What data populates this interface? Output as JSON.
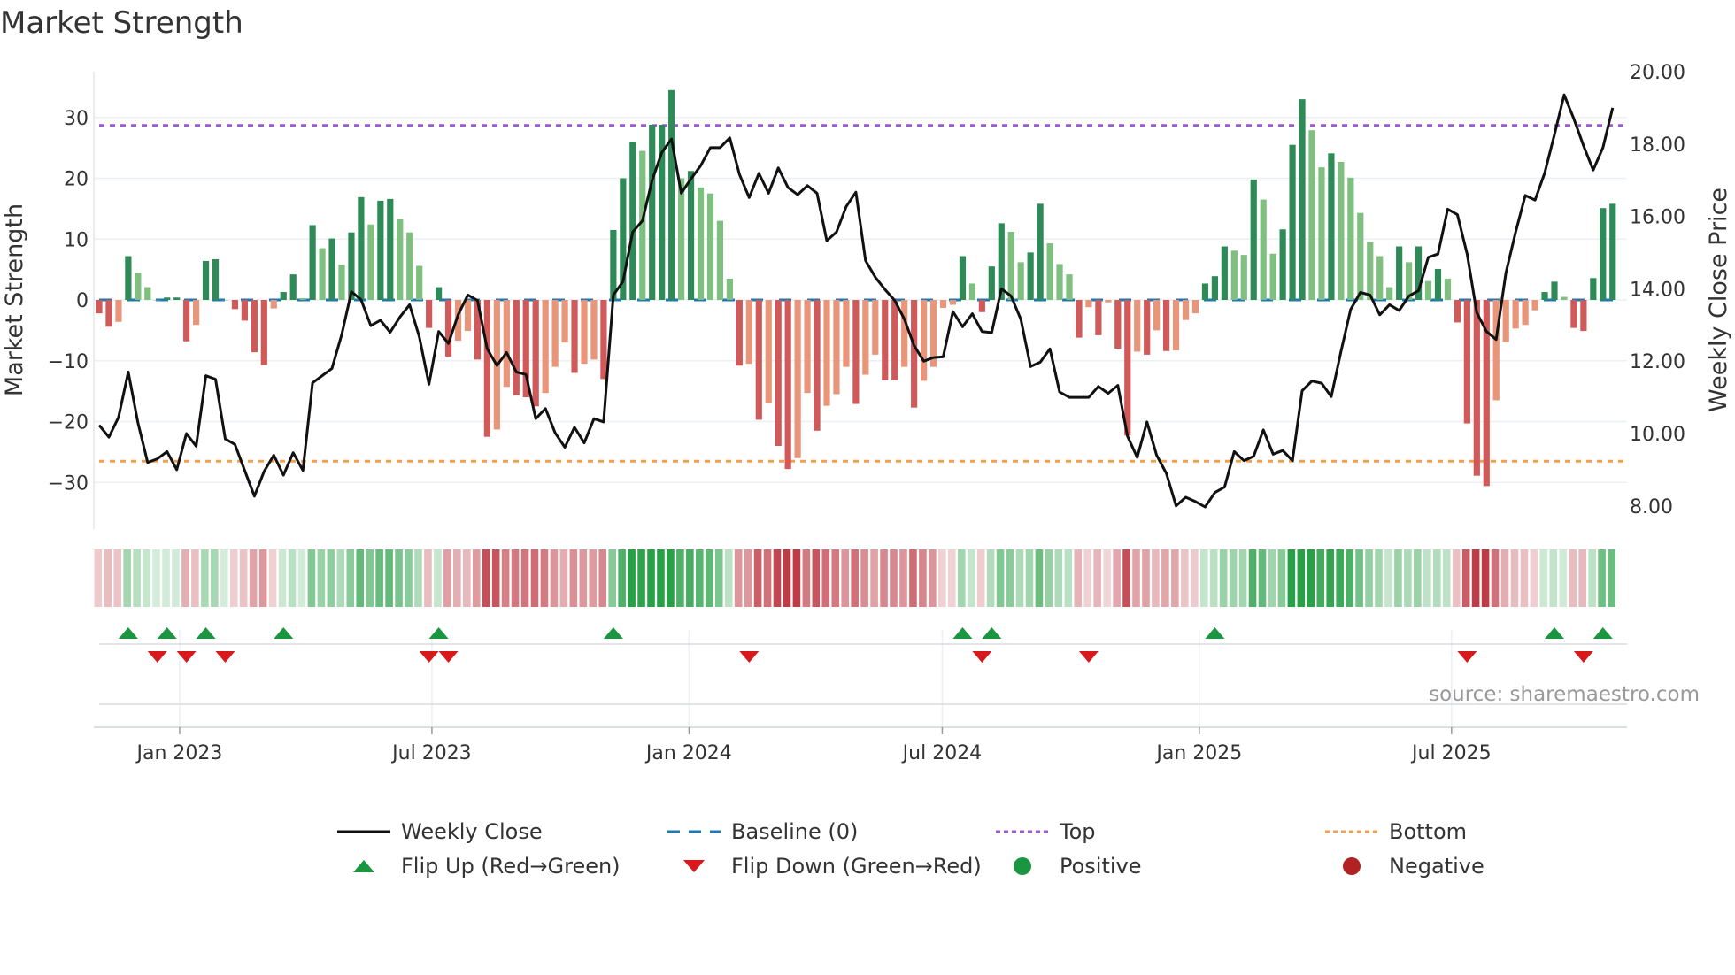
{
  "title": "Market Strength",
  "source": "source: sharemaestro.com",
  "colors": {
    "pos_dark": "#2e8b57",
    "pos_light": "#7fbf7f",
    "neg_dark": "#d05a5a",
    "neg_light": "#e8957a",
    "line": "#111111",
    "baseline": "#1f77b4",
    "top": "#9b59d6",
    "bottom": "#f0a050",
    "flip_up": "#1a9641",
    "flip_down": "#d7191c",
    "positive": "#1a9641",
    "negative": "#b22222"
  },
  "chart_data": {
    "type": "bar+line",
    "title": "Market Strength",
    "ylabel": "Market Strength",
    "y2label": "Weekly Close Price",
    "ylim": [
      -37.5,
      39
    ],
    "y2lim": [
      8,
      20
    ],
    "yticks": [
      "30",
      "20",
      "10",
      "0",
      "−10",
      "−20",
      "−30"
    ],
    "ytick_values": [
      30,
      20,
      10,
      0,
      -10,
      -20,
      -30
    ],
    "y2ticks": [
      "20.00",
      "18.00",
      "16.00",
      "14.00",
      "12.00",
      "10.00",
      "8.00"
    ],
    "y2tick_values": [
      20,
      18,
      16,
      14,
      12,
      10,
      8
    ],
    "top_level": 28.7,
    "bottom_level": -26.5,
    "xticks": [
      {
        "label": "Jan 2023",
        "week": 8.3
      },
      {
        "label": "Jul 2023",
        "week": 34.3
      },
      {
        "label": "Jan 2024",
        "week": 60.8
      },
      {
        "label": "Jul 2024",
        "week": 86.9
      },
      {
        "label": "Jan 2025",
        "week": 113.4
      },
      {
        "label": "Jul 2025",
        "week": 139.4
      }
    ],
    "strength": [
      -2.2,
      -4.4,
      -3.6,
      7.2,
      4.5,
      2.1,
      0,
      0.4,
      0.4,
      -6.8,
      -4.1,
      6.4,
      6.7,
      0,
      -1.5,
      -3.4,
      -8.6,
      -10.7,
      -1.4,
      1.3,
      4.2,
      0.3,
      12.3,
      8.5,
      10.1,
      5.8,
      11.1,
      16.9,
      12.4,
      16.3,
      16.6,
      13.3,
      11.1,
      5.6,
      -4.6,
      2.1,
      -9.3,
      -6.7,
      -5.1,
      -9.8,
      -22.5,
      -21.3,
      -14.3,
      -15.7,
      -16,
      -17.5,
      -15.3,
      -11,
      -7,
      -12,
      -10.5,
      -9.8,
      -13,
      11.5,
      20,
      26,
      24.5,
      28.8,
      28.8,
      34.5,
      20,
      21.2,
      18.5,
      17.5,
      13,
      3.5,
      -10.8,
      -10.5,
      -19.7,
      -17,
      -24,
      -27.8,
      -26,
      -15.3,
      -21.5,
      -17.4,
      -15.5,
      -11,
      -17.1,
      -12.3,
      -9,
      -13.2,
      -13.2,
      -11,
      -17.7,
      -13.3,
      -11,
      -1.3,
      -0.8,
      7.2,
      2.7,
      -2,
      5.5,
      12.6,
      11.2,
      6.2,
      7.8,
      15.8,
      9.3,
      5.9,
      4.2,
      -6.2,
      -1.2,
      -5.8,
      -0.4,
      -8,
      -22.3,
      -8.5,
      -9,
      -5,
      -8.4,
      -8.3,
      -3.3,
      -2.2,
      2.7,
      3.9,
      8.8,
      8.1,
      7.4,
      19.8,
      16.5,
      7.6,
      11.6,
      25.5,
      33,
      27.9,
      21.8,
      24.1,
      22.7,
      20.1,
      14.3,
      9.5,
      7.2,
      2.1,
      8.8,
      6.2,
      8.8,
      3.1,
      5.1,
      3.5,
      -3.7,
      -20.3,
      -28.9,
      -30.6,
      -16.5,
      -6.9,
      -4.7,
      -4.1,
      -1.7,
      1.3,
      3,
      0.5,
      -4.6,
      -5.1,
      3.6,
      15.1,
      15.8
    ],
    "weekly_close": [
      10.23,
      9.9,
      10.45,
      11.7,
      10.3,
      9.2,
      9.3,
      9.5,
      9.0,
      10.0,
      9.65,
      11.6,
      11.5,
      9.85,
      9.7,
      8.98,
      8.27,
      8.95,
      9.4,
      8.85,
      9.47,
      8.98,
      11.4,
      11.6,
      11.8,
      12.73,
      13.92,
      13.7,
      12.98,
      13.13,
      12.8,
      13.22,
      13.56,
      12.67,
      11.36,
      12.82,
      12.49,
      13.28,
      13.83,
      13.68,
      12.34,
      11.88,
      12.24,
      11.7,
      11.63,
      10.41,
      10.69,
      10.02,
      9.62,
      10.17,
      9.74,
      10.41,
      10.32,
      13.83,
      14.2,
      15.57,
      15.88,
      17.0,
      17.77,
      18.14,
      16.64,
      17.04,
      17.4,
      17.9,
      17.9,
      18.17,
      17.16,
      16.52,
      17.19,
      16.64,
      17.34,
      16.8,
      16.6,
      16.85,
      16.64,
      15.33,
      15.57,
      16.27,
      16.67,
      14.78,
      14.32,
      13.98,
      13.68,
      13.16,
      12.43,
      12.0,
      12.1,
      12.12,
      13.37,
      12.95,
      13.31,
      12.82,
      12.79,
      14.0,
      13.8,
      13.16,
      11.85,
      11.97,
      12.34,
      11.15,
      11.0,
      11.0,
      11.0,
      11.3,
      11.11,
      11.33,
      9.92,
      9.34,
      10.32,
      9.4,
      8.9,
      8.0,
      8.24,
      8.12,
      7.97,
      8.37,
      8.52,
      9.5,
      9.25,
      9.37,
      10.1,
      9.43,
      9.53,
      9.25,
      11.18,
      11.45,
      11.39,
      11.02,
      12.27,
      13.43,
      13.9,
      13.83,
      13.28,
      13.56,
      13.4,
      13.8,
      13.95,
      14.87,
      14.96,
      16.2,
      16.05,
      14.96,
      13.34,
      12.82,
      12.6,
      14.44,
      15.57,
      16.58,
      16.45,
      17.2,
      18.26,
      19.36,
      18.7,
      17.95,
      17.28,
      17.9,
      19.0
    ],
    "flip_up_weeks": [
      3,
      7,
      11,
      19,
      35,
      53,
      89,
      92,
      115,
      150,
      155
    ],
    "flip_down_weeks": [
      6,
      9,
      13,
      34,
      36,
      67,
      91,
      102,
      141,
      153
    ]
  },
  "legend": [
    {
      "label": "Weekly Close",
      "key": "line"
    },
    {
      "label": "Baseline (0)",
      "key": "baseline"
    },
    {
      "label": "Top",
      "key": "top"
    },
    {
      "label": "Bottom",
      "key": "bottom"
    },
    {
      "label": "Flip Up (Red→Green)",
      "key": "flip_up"
    },
    {
      "label": "Flip Down (Green→Red)",
      "key": "flip_down"
    },
    {
      "label": "Positive",
      "key": "positive"
    },
    {
      "label": "Negative",
      "key": "negative"
    }
  ]
}
